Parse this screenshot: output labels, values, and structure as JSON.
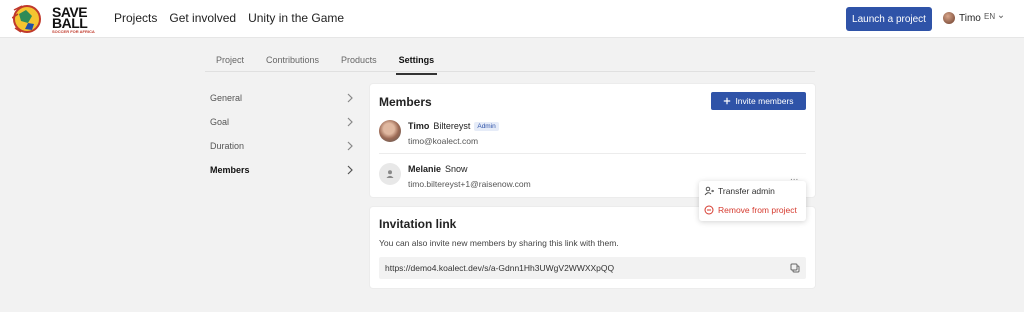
{
  "brand": {
    "line1": "SAVE",
    "line2": "BALL",
    "tagline": "SOCCER FOR AFRICA"
  },
  "nav": {
    "links": [
      "Projects",
      "Get involved",
      "Unity in the Game"
    ],
    "launch_label": "Launch a project",
    "user_name": "Timo",
    "language": "EN"
  },
  "tabs": [
    "Project",
    "Contributions",
    "Products",
    "Settings"
  ],
  "active_tab": "Settings",
  "sidemenu": [
    "General",
    "Goal",
    "Duration",
    "Members"
  ],
  "members_card": {
    "title": "Members",
    "invite_label": "Invite members",
    "members": [
      {
        "first": "Timo",
        "last": "Biltereyst",
        "badge": "Admin",
        "email": "timo@koalect.com"
      },
      {
        "first": "Melanie",
        "last": "Snow",
        "email": "timo.biltereyst+1@raisenow.com"
      }
    ],
    "more_label": "..."
  },
  "dropdown": {
    "transfer_label": "Transfer admin",
    "remove_label": "Remove from project"
  },
  "invitation_card": {
    "title": "Invitation link",
    "description": "You can also invite new members by sharing this link with them.",
    "link": "https://demo4.koalect.dev/s/a-Gdnn1Hh3UWgV2WWXXpQQ"
  },
  "colors": {
    "primary": "#2f53a8",
    "danger": "#d63a2e"
  }
}
